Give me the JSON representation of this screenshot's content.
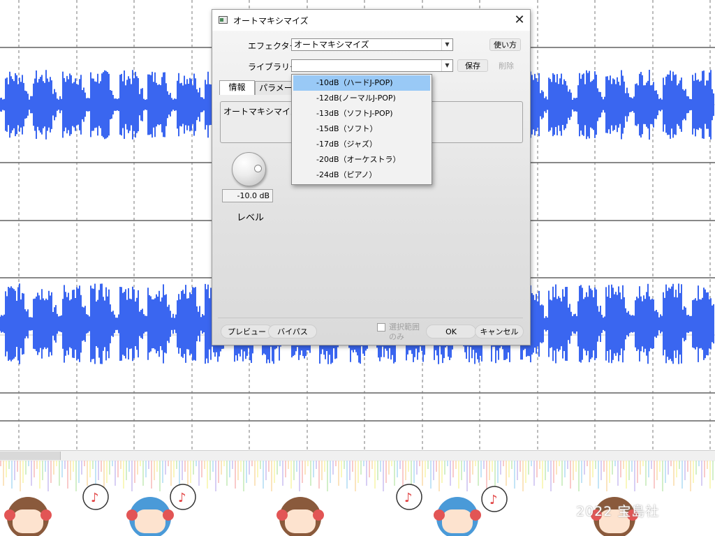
{
  "window": {
    "title": "オートマキシマイズ",
    "close_glyph": "✕"
  },
  "form": {
    "effector_label": "エフェクター",
    "effector_value": "オートマキシマイズ",
    "usage_button": "使い方",
    "library_label": "ライブラリー",
    "library_value": "",
    "save_button": "保存",
    "delete_button": "削除"
  },
  "tabs": [
    {
      "label": "情報"
    },
    {
      "label": "パラメー"
    }
  ],
  "info": {
    "text": "オートマキシマイズ平"
  },
  "level": {
    "value_text": "-10.0 dB",
    "label": "レベル"
  },
  "footer": {
    "preview_button": "プレビュー",
    "bypass_button": "バイパス",
    "selection_only_label": "選択範囲のみ",
    "ok_button": "OK",
    "cancel_button": "キャンセル"
  },
  "dropdown": {
    "items": [
      {
        "label": "-10dB（ハードJ-POP)",
        "selected": true
      },
      {
        "label": "-12dB(ノーマルJ-POP)",
        "selected": false
      },
      {
        "label": "-13dB（ソフトJ-POP)",
        "selected": false
      },
      {
        "label": "-15dB（ソフト）",
        "selected": false
      },
      {
        "label": "-17dB（ジャズ）",
        "selected": false
      },
      {
        "label": "-20dB（オーケストラ）",
        "selected": false
      },
      {
        "label": "-24dB（ピアノ）",
        "selected": false
      }
    ]
  },
  "background": {
    "copyright": "2022 宝島社"
  },
  "colors": {
    "waveform": "#3a66f0",
    "selection_highlight": "#99c9f6"
  }
}
